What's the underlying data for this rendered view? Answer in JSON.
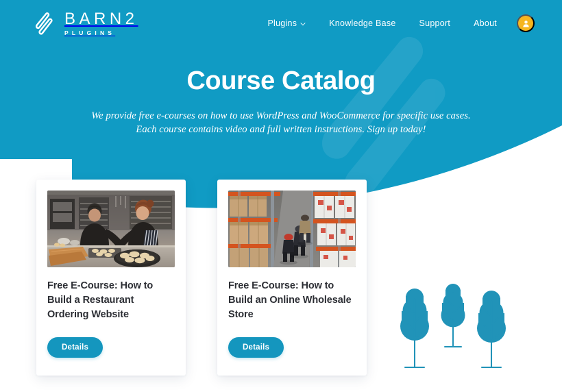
{
  "header": {
    "brand": {
      "name": "BARN2",
      "subtitle": "PLUGINS",
      "logo_icon": "barn2-double-slash-logo-icon"
    },
    "nav": [
      {
        "label": "Plugins",
        "has_dropdown": true,
        "icon": "chevron-down-icon"
      },
      {
        "label": "Knowledge Base",
        "has_dropdown": false
      },
      {
        "label": "Support",
        "has_dropdown": false
      },
      {
        "label": "About",
        "has_dropdown": false
      }
    ],
    "account": {
      "icon": "user-account-icon",
      "color": "#F5B520"
    }
  },
  "hero": {
    "title": "Course Catalog",
    "subtitle_line1": "We provide free e-courses on how to use WordPress and WooCommerce for specific use cases.",
    "subtitle_line2": "Each course contains video and full written instructions. Sign up today!",
    "background_color": "#109BC4",
    "watermark_icon": "barn2-logo-watermark-icon"
  },
  "courses": [
    {
      "title": "Free E-Course: How to Build a Restaurant Ordering Website",
      "cta_label": "Details",
      "image_alt": "restaurant-kitchen-chefs-preparing-food"
    },
    {
      "title": "Free E-Course: How to Build an Online Wholesale Store",
      "cta_label": "Details",
      "image_alt": "warehouse-aisle-with-pallets-and-workers"
    }
  ],
  "decoration": {
    "trees_icon": "three-stylized-trees-illustration",
    "tree_color": "#2193B8"
  },
  "colors": {
    "brand_blue": "#109BC4",
    "button_blue": "#1496BE",
    "accent_yellow": "#F5B520",
    "heading_dark": "#2C2E34"
  }
}
